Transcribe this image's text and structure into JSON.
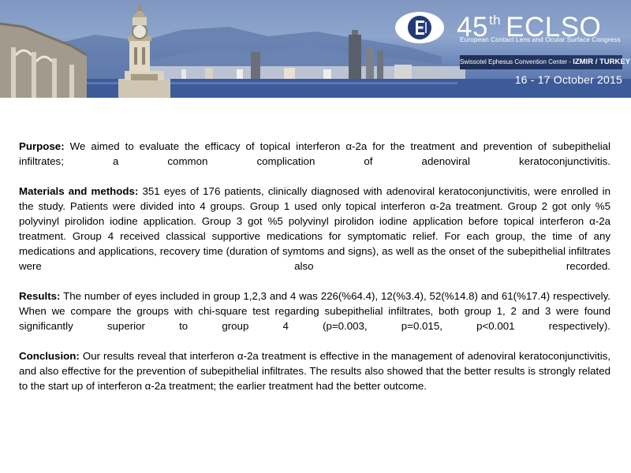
{
  "banner": {
    "ordinal": "45",
    "ordinal_suffix": "th",
    "event": "ECLSO",
    "logo_letter": "E",
    "subtitle": "European Contact Lens and Ocular Surface Congress",
    "venue_prefix": "Swissotel Ephesus Convention Center -",
    "venue_city": "IZMIR / TURKEY",
    "dates": "16 - 17 October 2015",
    "colors": {
      "sky": "#8ea5cc",
      "sea": "#3d5b99",
      "dark_band": "#1f2f55",
      "text": "#ffffff"
    }
  },
  "abstract": {
    "purpose": {
      "label": "Purpose:",
      "text": " We aimed to evaluate the efficacy of topical interferon α-2a for the treatment and prevention of subepithelial infiltrates; a common complication of adenoviral keratoconjunctivitis."
    },
    "methods": {
      "label": "Materials and methods:",
      "text": " 351 eyes of 176 patients, clinically diagnosed with adenoviral keratoconjunctivitis, were enrolled in the study. Patients were divided into 4 groups. Group 1 used only topical interferon α-2a treatment. Group 2 got only %5 polyvinyl pirolidon iodine application.  Group 3 got %5 polyvinyl pirolidon iodine application before topical interferon α-2a treatment. Group 4 received classical supportive medications for symptomatic relief. For each group, the time of any medications and applications, recovery time (duration of symtoms and signs),  as well as the onset of the subepithelial infiltrates were also recorded."
    },
    "results": {
      "label": "Results:",
      "text": " The number of eyes included in group 1,2,3 and 4 was 226(%64.4), 12(%3.4), 52(%14.8) and 61(%17.4) respectively. When we compare the groups with chi-square test regarding subepithelial infiltrates, both group 1, 2 and 3 were found significantly superior to group 4 (p=0.003, p=0.015, p<0.001 respectively)."
    },
    "conclusion": {
      "label": "Conclusion:",
      "text": " Our results reveal that interferon α-2a treatment is effective in the management of adenoviral keratoconjunctivitis, and also effective for the prevention of subepithelial infiltrates. The   results also showed that the better results is strongly related to the start up of interferon α-2a treatment; the earlier treatment had the better outcome."
    }
  }
}
